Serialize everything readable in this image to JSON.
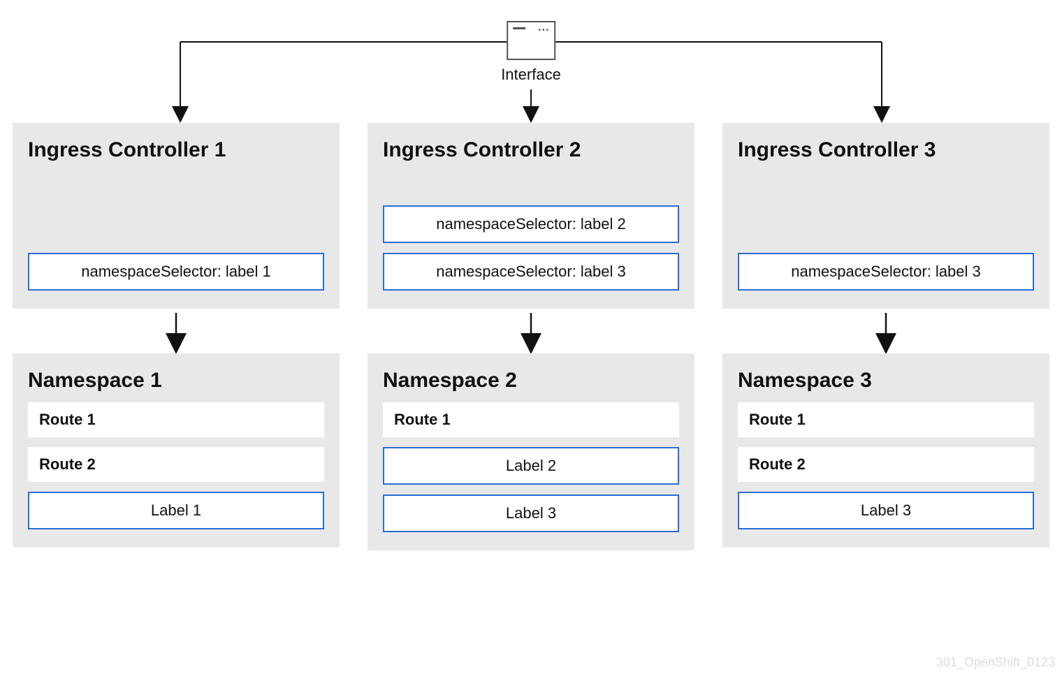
{
  "interface": {
    "label": "Interface"
  },
  "controllers": [
    {
      "title": "Ingress Controller 1",
      "selectors": [
        "namespaceSelector: label 1"
      ]
    },
    {
      "title": "Ingress Controller 2",
      "selectors": [
        "namespaceSelector: label 2",
        "namespaceSelector: label 3"
      ]
    },
    {
      "title": "Ingress Controller 3",
      "selectors": [
        "namespaceSelector: label 3"
      ]
    }
  ],
  "namespaces": [
    {
      "title": "Namespace 1",
      "items": [
        {
          "type": "route",
          "text": "Route 1"
        },
        {
          "type": "route",
          "text": "Route 2"
        },
        {
          "type": "label",
          "text": "Label 1"
        }
      ]
    },
    {
      "title": "Namespace 2",
      "items": [
        {
          "type": "route",
          "text": "Route 1"
        },
        {
          "type": "label",
          "text": "Label 2"
        },
        {
          "type": "label",
          "text": "Label 3"
        }
      ]
    },
    {
      "title": "Namespace 3",
      "items": [
        {
          "type": "route",
          "text": "Route 1"
        },
        {
          "type": "route",
          "text": "Route 2"
        },
        {
          "type": "label",
          "text": "Label 3"
        }
      ]
    }
  ],
  "footer": {
    "stamp": "301_OpenShift_0123"
  }
}
